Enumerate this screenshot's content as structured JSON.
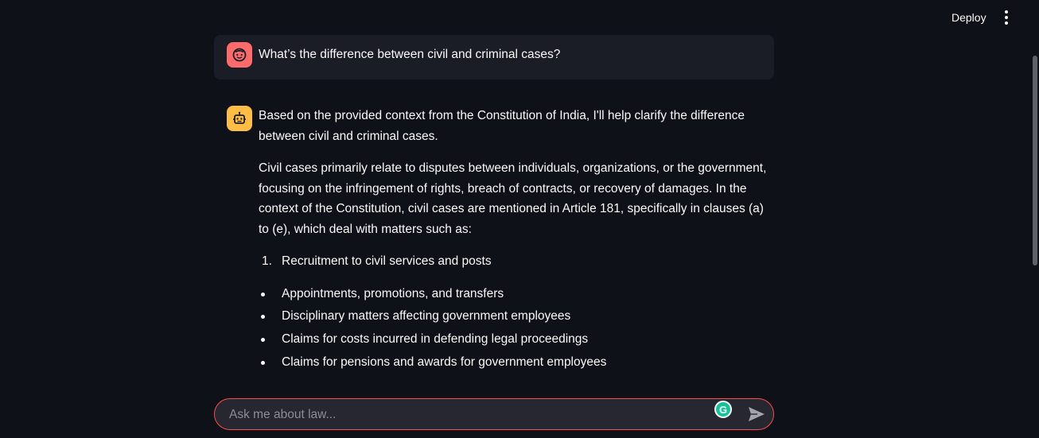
{
  "header": {
    "deploy_label": "Deploy",
    "menu_icon": "kebab-menu-icon"
  },
  "chat": {
    "user_message": {
      "avatar_icon": "user-face-icon",
      "text": "What’s the difference between civil and criminal cases?"
    },
    "assistant_message": {
      "avatar_icon": "robot-icon",
      "paragraphs": [
        "Based on the provided context from the Constitution of India, I'll help clarify the difference between civil and criminal cases.",
        "Civil cases primarily relate to disputes between individuals, organizations, or the government, focusing on the infringement of rights, breach of contracts, or recovery of damages. In the context of the Constitution, civil cases are mentioned in Article 181, specifically in clauses (a) to (e), which deal with matters such as:"
      ],
      "ordered_list": [
        {
          "num": "1.",
          "text": "Recruitment to civil services and posts"
        }
      ],
      "bullets": [
        "Appointments, promotions, and transfers",
        "Disciplinary matters affecting government employees",
        "Claims for costs incurred in defending legal proceedings",
        "Claims for pensions and awards for government employees"
      ]
    }
  },
  "input": {
    "placeholder": "Ask me about law...",
    "value": "",
    "grammarly_icon": "grammarly-icon",
    "send_icon": "send-icon"
  },
  "colors": {
    "background": "#0e1117",
    "user_bubble": "#1b1d26",
    "user_avatar": "#ff6b6b",
    "bot_avatar": "#ffbd45",
    "input_border": "#ff4b4b"
  }
}
